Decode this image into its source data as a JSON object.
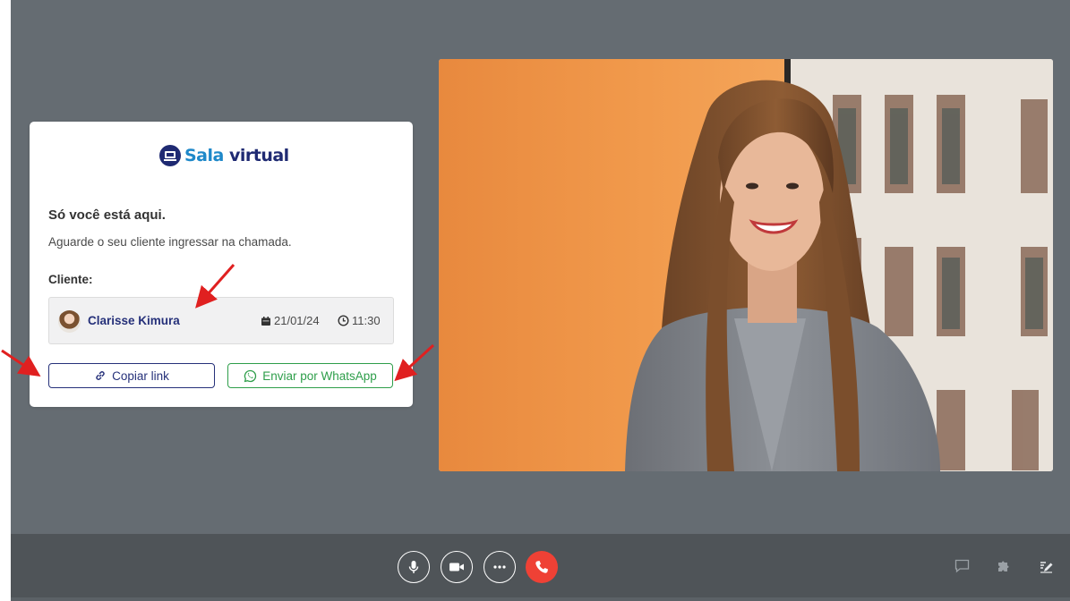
{
  "brand": {
    "logo_part1": "Sala",
    "logo_part2": "virtual",
    "color_light": "#1e88c9",
    "color_dark": "#1f2a72"
  },
  "waiting": {
    "title": "Só você está aqui.",
    "message": "Aguarde o seu cliente ingressar na chamada."
  },
  "client": {
    "label": "Cliente:",
    "name": "Clarisse Kimura",
    "date": "21/01/24",
    "time": "11:30"
  },
  "actions": {
    "copy_link": "Copiar link",
    "whatsapp": "Enviar por WhatsApp"
  },
  "toolbar": {
    "buttons": [
      {
        "icon": "microphone-icon"
      },
      {
        "icon": "video-camera-icon"
      },
      {
        "icon": "more-options-icon"
      },
      {
        "icon": "end-call-icon",
        "color": "#ef4135"
      }
    ],
    "right_icons": [
      "chat-icon",
      "extensions-icon",
      "notes-icon"
    ]
  },
  "colors": {
    "background": "#656c72",
    "toolbar": "#4f5458",
    "whatsapp_green": "#2e9e4a",
    "annotation_red": "#e02020"
  }
}
